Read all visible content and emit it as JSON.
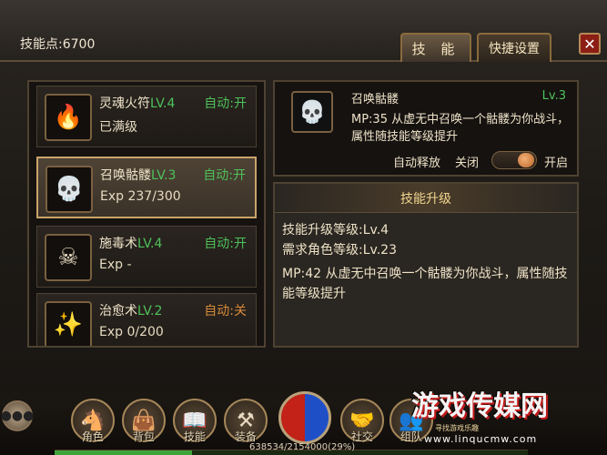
{
  "header": {
    "skill_points": "技能点:6700",
    "tabs": [
      {
        "label": "技 能"
      },
      {
        "label": "快捷设置"
      }
    ],
    "close_label": "✕"
  },
  "skill_list": [
    {
      "name": "灵魂火符",
      "level": "LV.4",
      "auto": "自动:开",
      "sub": "已满级",
      "icon": "fire-talisman-icon"
    },
    {
      "name": "召唤骷髅",
      "level": "LV.3",
      "auto": "自动:开",
      "sub": "Exp 237/300",
      "icon": "skull-icon"
    },
    {
      "name": "施毒术",
      "level": "LV.4",
      "auto": "自动:开",
      "sub": "Exp -",
      "icon": "poison-icon"
    },
    {
      "name": "治愈术",
      "level": "LV.2",
      "auto": "自动:关",
      "sub": "Exp 0/200",
      "icon": "heal-icon"
    }
  ],
  "detail": {
    "name": "召唤骷髅",
    "level": "Lv.3",
    "desc": "MP:35  从虚无中召唤一个骷髅为你战斗，属性随技能等级提升",
    "auto_cast_label": "自动释放",
    "toggle_off": "关闭",
    "toggle_on": "开启",
    "auto_cast_enabled": true
  },
  "upgrade": {
    "title": "技能升级",
    "skill_level_req": "技能升级等级:Lv.4",
    "char_level_req": "需求角色等级:Lv.23",
    "desc": "MP:42  从虚无中召唤一个骷髅为你战斗，属性随技能等级提升"
  },
  "bottom_menu": {
    "buttons": [
      {
        "label": "角色",
        "icon": "character-icon"
      },
      {
        "label": "背包",
        "icon": "bag-icon"
      },
      {
        "label": "技能",
        "icon": "skill-book-icon"
      },
      {
        "label": "装备",
        "icon": "equipment-icon"
      },
      {
        "label": "社交",
        "icon": "social-icon"
      },
      {
        "label": "组队",
        "icon": "team-icon"
      }
    ],
    "exp_text": "638534/2154000(29%)",
    "exp_percent": 29
  },
  "watermark": {
    "main": "游戏传媒网",
    "sub": "寻找游戏乐趣",
    "url": "www.linqucmw.com"
  },
  "colors": {
    "accent_green": "#4ec15a",
    "accent_orange": "#d88a3a",
    "gold": "#c9a46a"
  }
}
